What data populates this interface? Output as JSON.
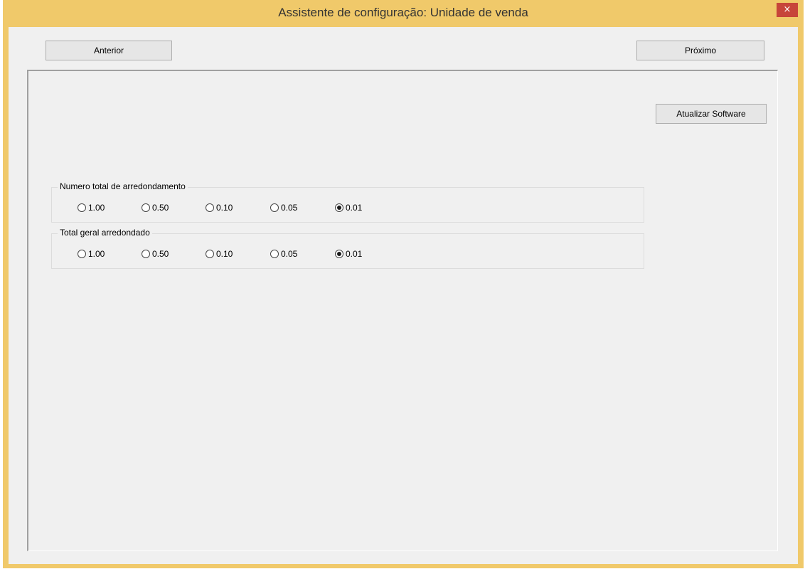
{
  "window": {
    "title": "Assistente de configuração: Unidade de venda",
    "close_symbol": "×"
  },
  "nav": {
    "prev_label": "Anterior",
    "next_label": "Próximo"
  },
  "panel": {
    "update_button_label": "Atualizar Software",
    "groups": [
      {
        "legend": "Numero total de arredondamento",
        "options": [
          "1.00",
          "0.50",
          "0.10",
          "0.05",
          "0.01"
        ],
        "selected": "0.01"
      },
      {
        "legend": "Total geral arredondado",
        "options": [
          "1.00",
          "0.50",
          "0.10",
          "0.05",
          "0.01"
        ],
        "selected": "0.01"
      }
    ]
  },
  "colors": {
    "titlebar": "#f0c96a",
    "close_button": "#c7453a",
    "client_background": "#f0f0f0"
  },
  "icons": {
    "close": "close-icon"
  }
}
